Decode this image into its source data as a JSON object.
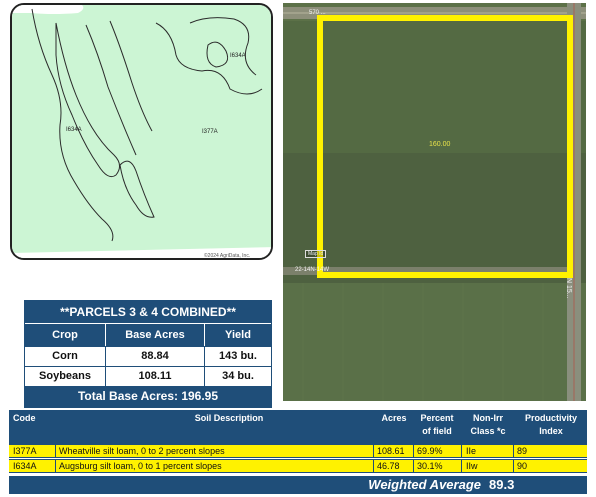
{
  "soil_map": {
    "labels": [
      "I634A",
      "I634A",
      "I377A"
    ],
    "copyright": "©2024 AgriData, Inc."
  },
  "aerial": {
    "acre_label": "160.00",
    "road_top": "570 ...",
    "road_left": "22-14N-14W",
    "ns_label": "N 15...",
    "map_box": "Map Id"
  },
  "parcels": {
    "title": "**PARCELS 3 & 4 COMBINED**",
    "headers": [
      "Crop",
      "Base Acres",
      "Yield"
    ],
    "rows": [
      [
        "Corn",
        "88.84",
        "143 bu."
      ],
      [
        "Soybeans",
        "108.11",
        "34 bu."
      ]
    ],
    "total": "Total Base Acres:  196.95"
  },
  "soil_table": {
    "headers": {
      "code": "Code",
      "description": "Soil Description",
      "acres": "Acres",
      "percent_line1": "Percent",
      "percent_line2": "of field",
      "class_line1": "Non-Irr",
      "class_line2": "Class *c",
      "pi_line1": "Productivity",
      "pi_line2": "Index"
    },
    "rows": [
      {
        "code": "I377A",
        "description": "Wheatville silt loam, 0 to 2 percent slopes",
        "acres": "108.61",
        "percent": "69.9%",
        "class": "IIe",
        "pi": "89"
      },
      {
        "code": "I634A",
        "description": "Augsburg silt loam, 0 to 1 percent slopes",
        "acres": "46.78",
        "percent": "30.1%",
        "class": "IIw",
        "pi": "90"
      }
    ],
    "weighted_average_label": "Weighted Average",
    "weighted_average_value": "89.3"
  }
}
